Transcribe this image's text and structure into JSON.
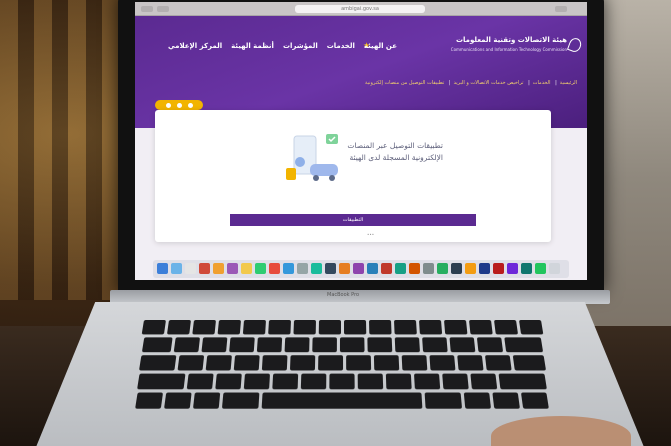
{
  "browser": {
    "url": "ambigai.gov.sa"
  },
  "site": {
    "logo_text": "هيئة الاتصالات وتقنية المعلومات",
    "logo_sub": "Communications and Information Technology Commission",
    "nav": [
      "عن الهيئة",
      "الخدمات",
      "المؤشرات",
      "أنظمة الهيئة",
      "المركز الإعلامي"
    ],
    "breadcrumb": [
      "الرئيسية",
      "الخدمات",
      "تراخيص خدمات الاتصالات و البريد",
      "تطبيقات التوصيل من منصات إلكترونية"
    ],
    "card_heading": "تطبيقات التوصيل عبر المنصات الإلكترونية المسجلة لدى الهيئة",
    "cta_label": "التطبيقات",
    "below_text": "•••"
  },
  "hardware": {
    "brand": "MacBook Pro"
  },
  "colors": {
    "brand_purple": "#5b2a91",
    "accent_yellow": "#f2b400"
  },
  "icons": {
    "star": "star-icon",
    "illustration": "delivery-apps-illustration"
  }
}
